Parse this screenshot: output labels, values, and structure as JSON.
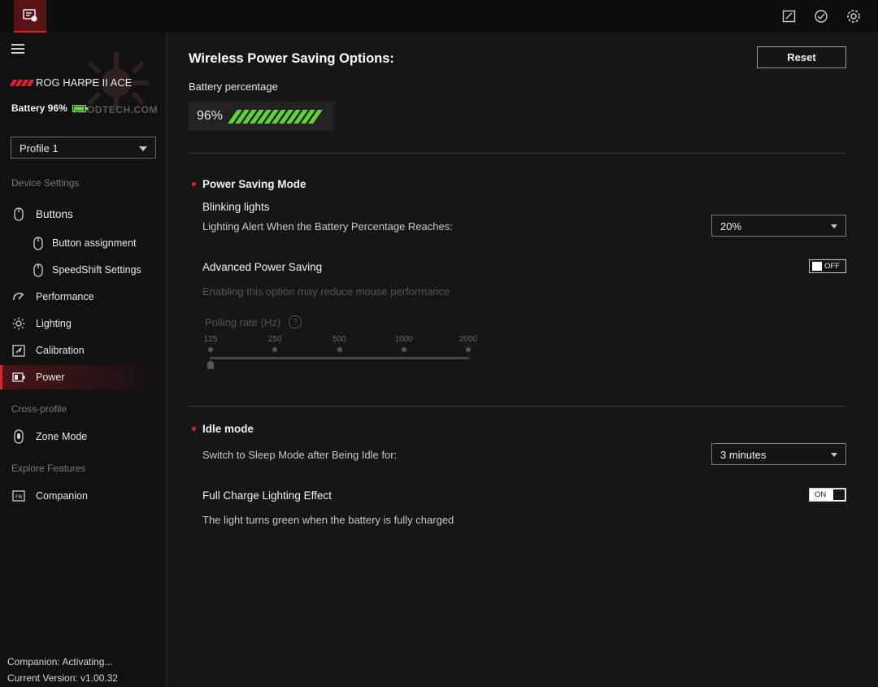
{
  "sidebar": {
    "device_name": "ROG HARPE II ACE",
    "battery_text": "Battery 96%",
    "watermark": "VMODTECH.COM",
    "profile": "Profile 1",
    "section_device": "Device Settings",
    "section_cross": "Cross-profile",
    "section_explore": "Explore Features",
    "items": {
      "buttons": "Buttons",
      "button_assignment": "Button assignment",
      "speedshift": "SpeedShift Settings",
      "performance": "Performance",
      "lighting": "Lighting",
      "calibration": "Calibration",
      "power": "Power",
      "zone_mode": "Zone Mode",
      "companion": "Companion"
    },
    "footer_status": "Companion: Activating...",
    "footer_version": "Current Version: v1.00.32"
  },
  "main": {
    "title": "Wireless Power Saving Options:",
    "reset_label": "Reset",
    "battery_label": "Battery percentage",
    "battery_pct_text": "96%",
    "battery_level": 0.96,
    "power_saving": {
      "heading": "Power Saving Mode",
      "blinking_title": "Blinking lights",
      "blinking_sub": "Lighting Alert When the Battery Percentage Reaches:",
      "blinking_value": "20%",
      "advanced_title": "Advanced Power Saving",
      "advanced_toggle": "OFF",
      "advanced_desc": "Enabling this option may reduce mouse performance",
      "polling_label": "Polling rate (Hz)",
      "polling_help": "?",
      "polling_ticks": [
        "125",
        "250",
        "500",
        "1000",
        "2000"
      ],
      "polling_value": "125"
    },
    "idle": {
      "heading": "Idle mode",
      "sleep_label": "Switch to Sleep Mode after Being Idle for:",
      "sleep_value": "3 minutes",
      "charge_title": "Full Charge Lighting Effect",
      "charge_toggle": "ON",
      "charge_desc": "The light turns green when the battery is fully charged"
    }
  },
  "colors": {
    "accent": "#e2232a",
    "battery_green": "#5fd43a",
    "background": "#161616",
    "sidebar": "#111111"
  }
}
